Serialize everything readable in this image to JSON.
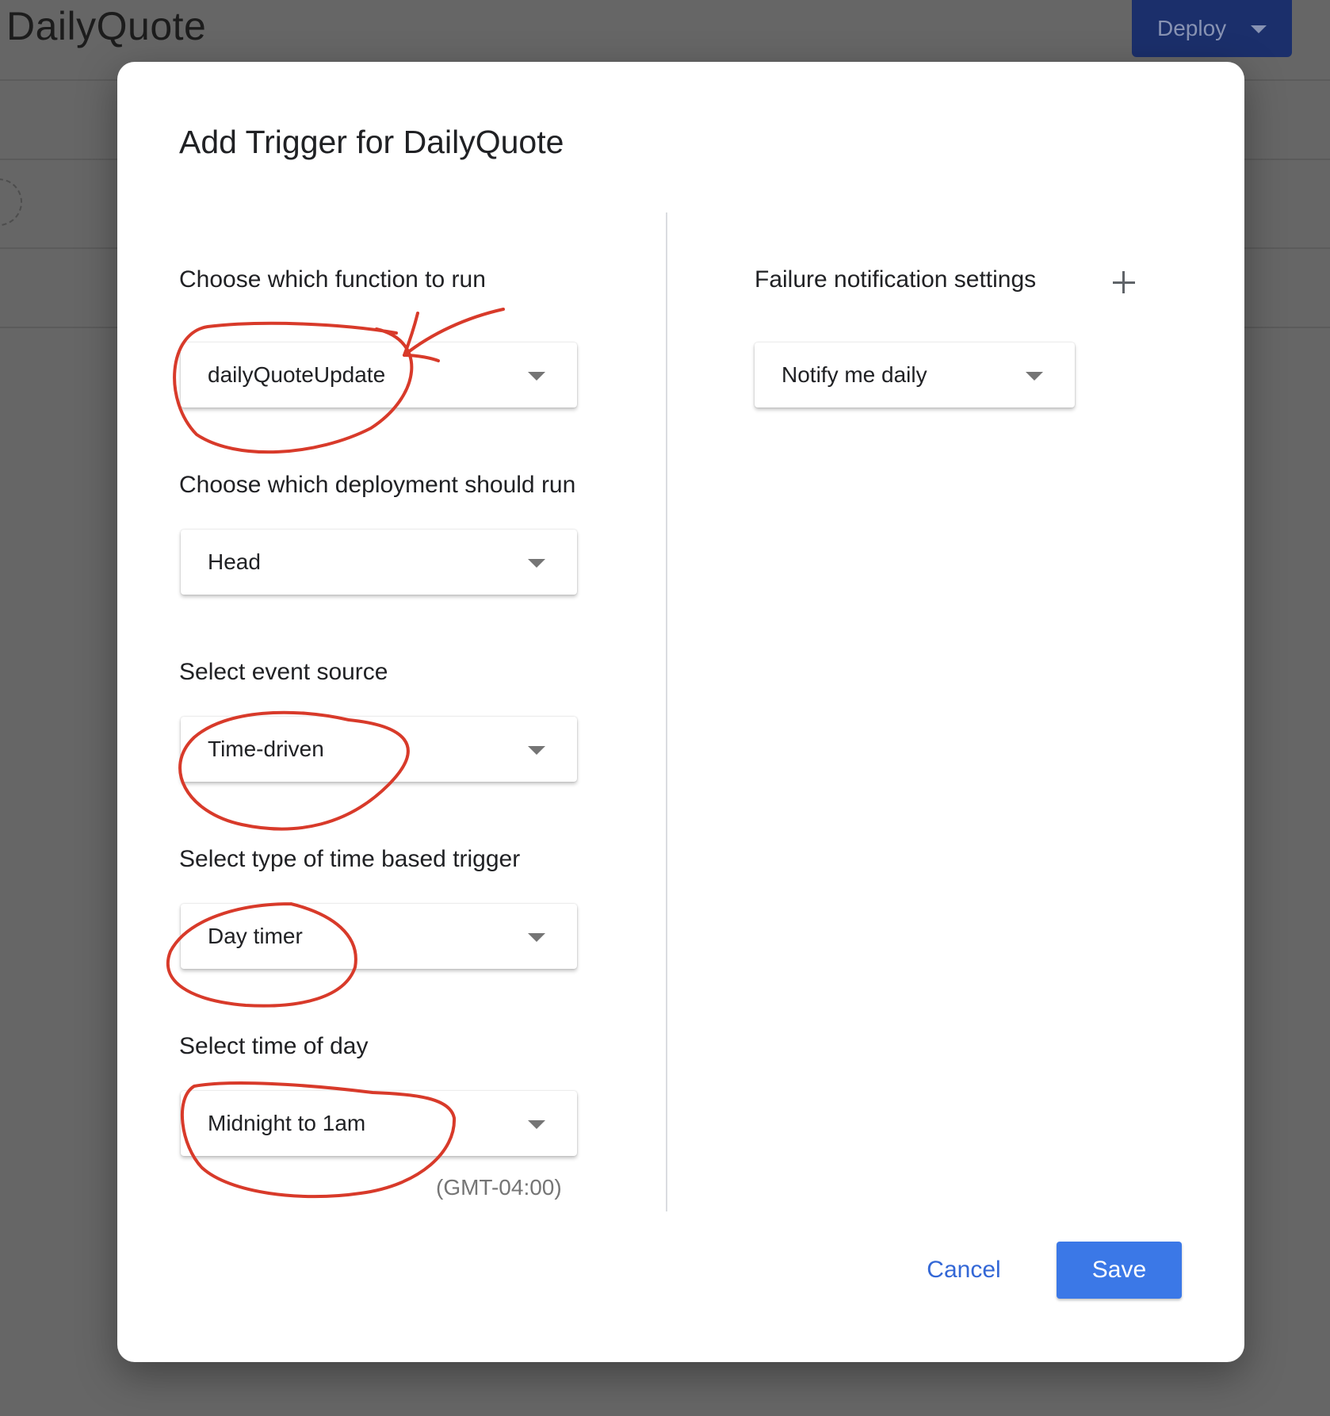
{
  "app": {
    "title": "DailyQuote",
    "deploy_label": "Deploy"
  },
  "dialog": {
    "title": "Add Trigger for DailyQuote",
    "fields": [
      {
        "label": "Choose which function to run",
        "value": "dailyQuoteUpdate"
      },
      {
        "label": "Choose which deployment should run",
        "value": "Head"
      },
      {
        "label": "Select event source",
        "value": "Time-driven"
      },
      {
        "label": "Select type of time based trigger",
        "value": "Day timer"
      },
      {
        "label": "Select time of day",
        "value": "Midnight to 1am"
      }
    ],
    "timezone_note": "(GMT-04:00)",
    "failure": {
      "label": "Failure notification settings",
      "value": "Notify me daily"
    },
    "buttons": {
      "cancel": "Cancel",
      "save": "Save"
    }
  },
  "colors": {
    "annotation": "#d83a2a",
    "primary": "#3b78e7",
    "link": "#3367d6",
    "deploy_background": "#1b2f6b"
  },
  "icons": {
    "dropdown": "caret-down-icon",
    "add": "plus-icon"
  }
}
